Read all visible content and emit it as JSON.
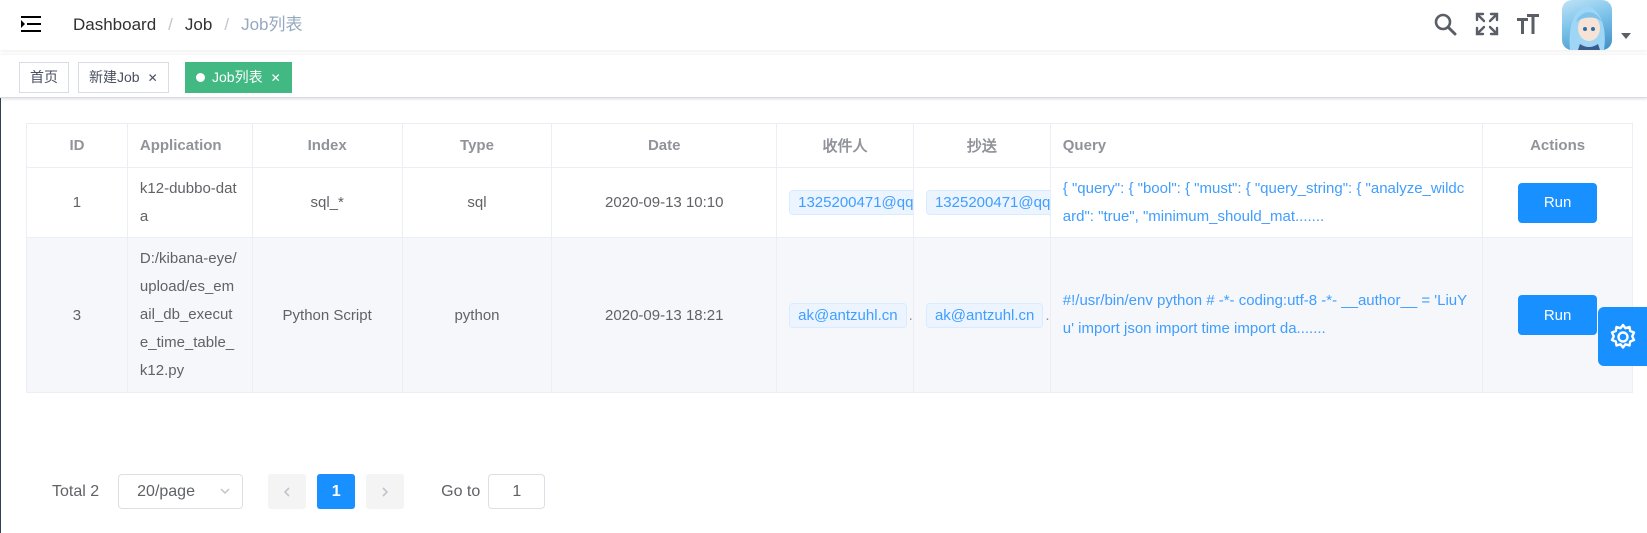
{
  "breadcrumb": [
    "Dashboard",
    "Job",
    "Job列表"
  ],
  "tags": [
    {
      "label": "首页",
      "closable": false,
      "active": false
    },
    {
      "label": "新建Job",
      "closable": true,
      "active": false
    },
    {
      "label": "Job列表",
      "closable": true,
      "active": true
    }
  ],
  "table": {
    "headers": [
      "ID",
      "Application",
      "Index",
      "Type",
      "Date",
      "收件人",
      "抄送",
      "Query",
      "Actions"
    ],
    "rows": [
      {
        "id": "1",
        "application": "k12-dubbo-data",
        "index": "sql_*",
        "type": "sql",
        "date": "2020-09-13 10:10",
        "receiver": "1325200471@qq",
        "cc": "1325200471@qq",
        "query": "{ \"query\": { \"bool\": { \"must\": { \"query_string\": { \"analyze_wildcard\": \"true\", \"minimum_should_mat.......",
        "action": "Run"
      },
      {
        "id": "3",
        "application": "D:/kibana-eye/upload/es_email_db_execute_time_table_k12.py",
        "index": "Python Script",
        "type": "python",
        "date": "2020-09-13 18:21",
        "receiver": "ak@antzuhl.cn",
        "cc": "ak@antzuhl.cn",
        "query": "#!/usr/bin/env python # -*- coding:utf-8 -*- __author__ = 'LiuYu' import json import time import da.......",
        "action": "Run"
      }
    ]
  },
  "pagination": {
    "total_label": "Total 2",
    "page_size": "20/page",
    "current_page": "1",
    "goto_label": "Go to",
    "goto_value": "1"
  },
  "icons": {
    "hamburger": "hamburger-icon",
    "search": "search-icon",
    "fullscreen": "fullscreen-icon",
    "font_size": "font-size-icon",
    "settings": "gear-icon"
  },
  "colors": {
    "primary": "#1890ff",
    "active_tag": "#42b983",
    "link_text": "#409eff"
  }
}
